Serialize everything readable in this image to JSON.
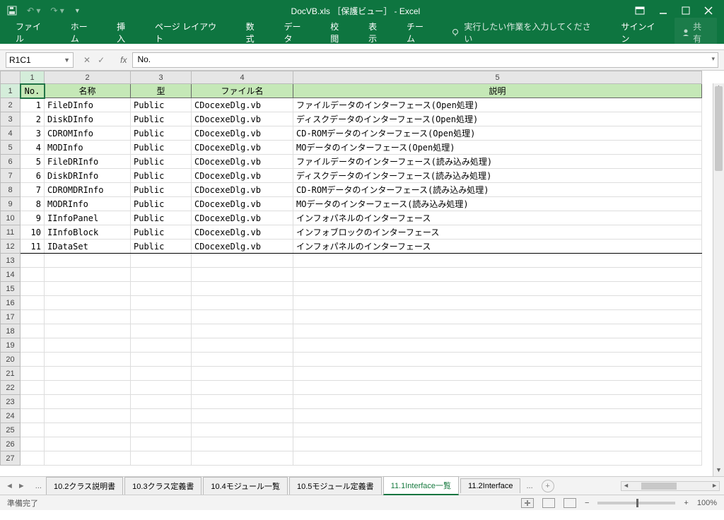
{
  "title": "DocVB.xls ［保護ビュー］ - Excel",
  "ribbon": {
    "file": "ファイル",
    "home": "ホーム",
    "insert": "挿入",
    "layout": "ページ レイアウト",
    "formulas": "数式",
    "data": "データ",
    "review": "校閲",
    "view": "表示",
    "team": "チーム",
    "tellme": "実行したい作業を入力してください",
    "signin": "サインイン",
    "share": "共有"
  },
  "namebox": "R1C1",
  "formula": "No.",
  "columns": [
    "1",
    "2",
    "3",
    "4",
    "5"
  ],
  "headers": {
    "no": "No.",
    "name": "名称",
    "type": "型",
    "file": "ファイル名",
    "desc": "説明"
  },
  "rows": [
    {
      "n": "1",
      "name": "FileDInfo",
      "type": "Public",
      "file": "CDocexeDlg.vb",
      "desc": "ファイルデータのインターフェース(Open処理)"
    },
    {
      "n": "2",
      "name": "DiskDInfo",
      "type": "Public",
      "file": "CDocexeDlg.vb",
      "desc": "ディスクデータのインターフェース(Open処理)"
    },
    {
      "n": "3",
      "name": "CDROMInfo",
      "type": "Public",
      "file": "CDocexeDlg.vb",
      "desc": "CD-ROMデータのインターフェース(Open処理)"
    },
    {
      "n": "4",
      "name": "MODInfo",
      "type": "Public",
      "file": "CDocexeDlg.vb",
      "desc": "MOデータのインターフェース(Open処理)"
    },
    {
      "n": "5",
      "name": "FileDRInfo",
      "type": "Public",
      "file": "CDocexeDlg.vb",
      "desc": "ファイルデータのインターフェース(読み込み処理)"
    },
    {
      "n": "6",
      "name": "DiskDRInfo",
      "type": "Public",
      "file": "CDocexeDlg.vb",
      "desc": "ディスクデータのインターフェース(読み込み処理)"
    },
    {
      "n": "7",
      "name": "CDROMDRInfo",
      "type": "Public",
      "file": "CDocexeDlg.vb",
      "desc": "CD-ROMデータのインターフェース(読み込み処理)"
    },
    {
      "n": "8",
      "name": "MODRInfo",
      "type": "Public",
      "file": "CDocexeDlg.vb",
      "desc": "MOデータのインターフェース(読み込み処理)"
    },
    {
      "n": "9",
      "name": "IInfoPanel",
      "type": "Public",
      "file": "CDocexeDlg.vb",
      "desc": "インフォパネルのインターフェース"
    },
    {
      "n": "10",
      "name": "IInfoBlock",
      "type": "Public",
      "file": "CDocexeDlg.vb",
      "desc": "インフォブロックのインターフェース"
    },
    {
      "n": "11",
      "name": "IDataSet",
      "type": "Public",
      "file": "CDocexeDlg.vb",
      "desc": "インフォパネルのインターフェース"
    }
  ],
  "sheets": {
    "t1": "10.2クラス説明書",
    "t2": "10.3クラス定義書",
    "t3": "10.4モジュール一覧",
    "t4": "10.5モジュール定義書",
    "t5": "11.1Interface一覧",
    "t6": "11.2Interface"
  },
  "status": {
    "ready": "準備完了",
    "zoom": "100%"
  }
}
